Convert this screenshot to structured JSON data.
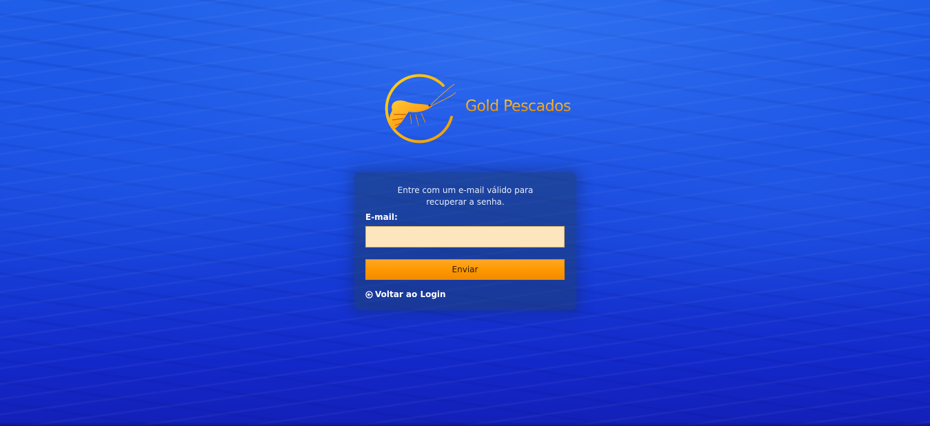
{
  "brand": {
    "name": "Gold Pescados",
    "logo_icon": "shrimp-logo-icon"
  },
  "recovery_form": {
    "instruction": "Entre com um e-mail válido para recuperar a senha.",
    "email_label": "E-mail:",
    "email_value": "",
    "email_placeholder": "",
    "submit_label": "Enviar",
    "back_link_label": "Voltar ao Login",
    "back_link_icon": "arrow-circle-left-icon"
  },
  "colors": {
    "background": "#1c52e4",
    "accent": "#ff9800",
    "input_background": "#fde6bd",
    "brand_gold": "#f4b018"
  }
}
